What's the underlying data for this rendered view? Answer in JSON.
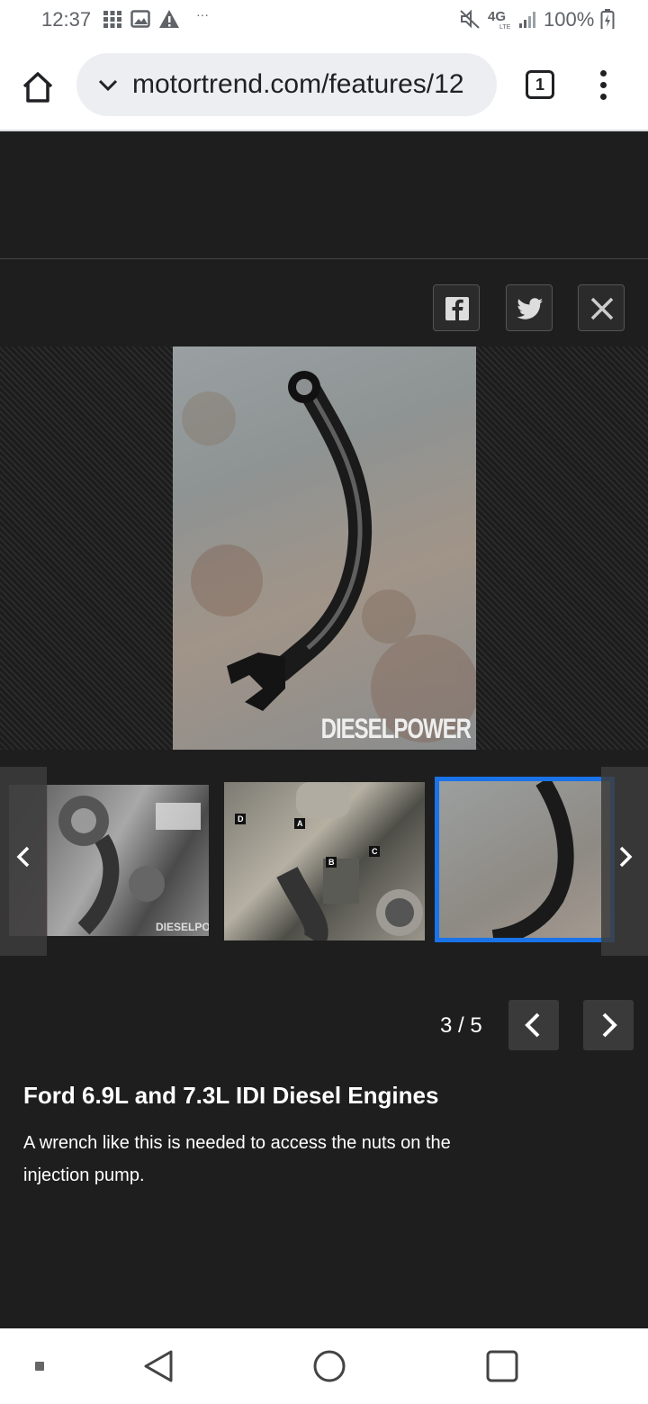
{
  "status_bar": {
    "time": "12:37",
    "ellipsis": "···",
    "network": "4G",
    "network_sub": "LTE",
    "battery": "100%"
  },
  "browser": {
    "url": "motortrend.com/features/12",
    "tab_count": "1"
  },
  "gallery": {
    "counter": "3 / 5",
    "watermark": "DIESELPOWER",
    "thumb_watermark": "DIESELPOWER",
    "title": "Ford 6.9L and 7.3L IDI Diesel Engines",
    "caption": "A wrench like this is needed to access the nuts on the injection pump.",
    "labels": [
      "D",
      "A",
      "B",
      "C"
    ]
  },
  "colors": {
    "accent": "#1a73e8",
    "background": "#1e1e1e"
  }
}
